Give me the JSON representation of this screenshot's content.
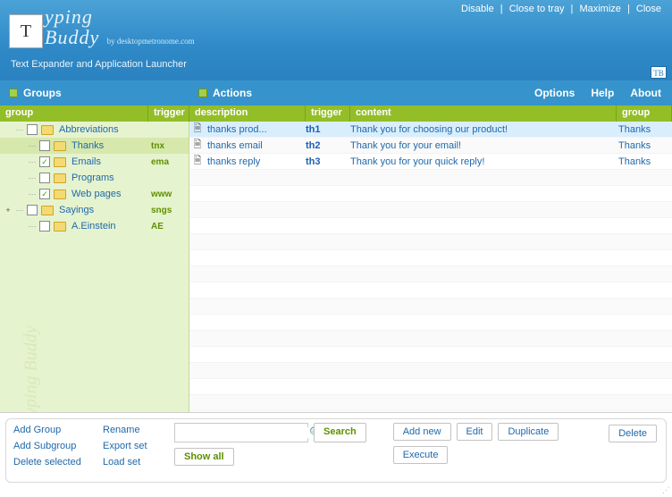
{
  "window": {
    "disable": "Disable",
    "close_tray": "Close to tray",
    "maximize": "Maximize",
    "close": "Close"
  },
  "branding": {
    "logo_letter": "T",
    "title_line1": "yping",
    "title_line2": "Buddy",
    "byline": "by desktopmetronome.com",
    "subtitle": "Text Expander and Application Launcher",
    "badge": "TB"
  },
  "sections": {
    "groups": "Groups",
    "actions": "Actions"
  },
  "menu": {
    "options": "Options",
    "help": "Help",
    "about": "About"
  },
  "headers": {
    "group": "group",
    "trigger": "trigger",
    "description": "description",
    "trigger2": "trigger",
    "content": "content",
    "group2": "group"
  },
  "tree": [
    {
      "name": "Abbreviations",
      "trigger": "",
      "checked": false,
      "sel": false,
      "level": 0
    },
    {
      "name": "Thanks",
      "trigger": "tnx",
      "checked": false,
      "sel": true,
      "level": 1
    },
    {
      "name": "Emails",
      "trigger": "ema",
      "checked": true,
      "sel": false,
      "level": 1
    },
    {
      "name": "Programs",
      "trigger": "",
      "checked": false,
      "sel": false,
      "level": 1
    },
    {
      "name": "Web pages",
      "trigger": "www",
      "checked": true,
      "sel": false,
      "level": 1
    },
    {
      "name": "Sayings",
      "trigger": "sngs",
      "checked": false,
      "sel": false,
      "level": 0,
      "expander": "+"
    },
    {
      "name": "A.Einstein",
      "trigger": "AE",
      "checked": false,
      "sel": false,
      "level": 1
    }
  ],
  "list": [
    {
      "desc": "thanks prod...",
      "trigger": "th1",
      "content": "Thank you for choosing our product!",
      "group": "Thanks",
      "sel": true
    },
    {
      "desc": "thanks email",
      "trigger": "th2",
      "content": "Thank you for your email!",
      "group": "Thanks",
      "sel": false
    },
    {
      "desc": "thanks reply",
      "trigger": "th3",
      "content": "Thank you for your quick reply!",
      "group": "Thanks",
      "sel": false
    }
  ],
  "bottom": {
    "col1": {
      "add_group": "Add Group",
      "add_subgroup": "Add Subgroup",
      "delete_selected": "Delete selected"
    },
    "col2": {
      "rename": "Rename",
      "export": "Export set",
      "load": "Load set"
    },
    "search_placeholder": "",
    "search_btn": "Search",
    "show_all": "Show all",
    "add_new": "Add new",
    "edit": "Edit",
    "duplicate": "Duplicate",
    "execute": "Execute",
    "delete": "Delete"
  }
}
